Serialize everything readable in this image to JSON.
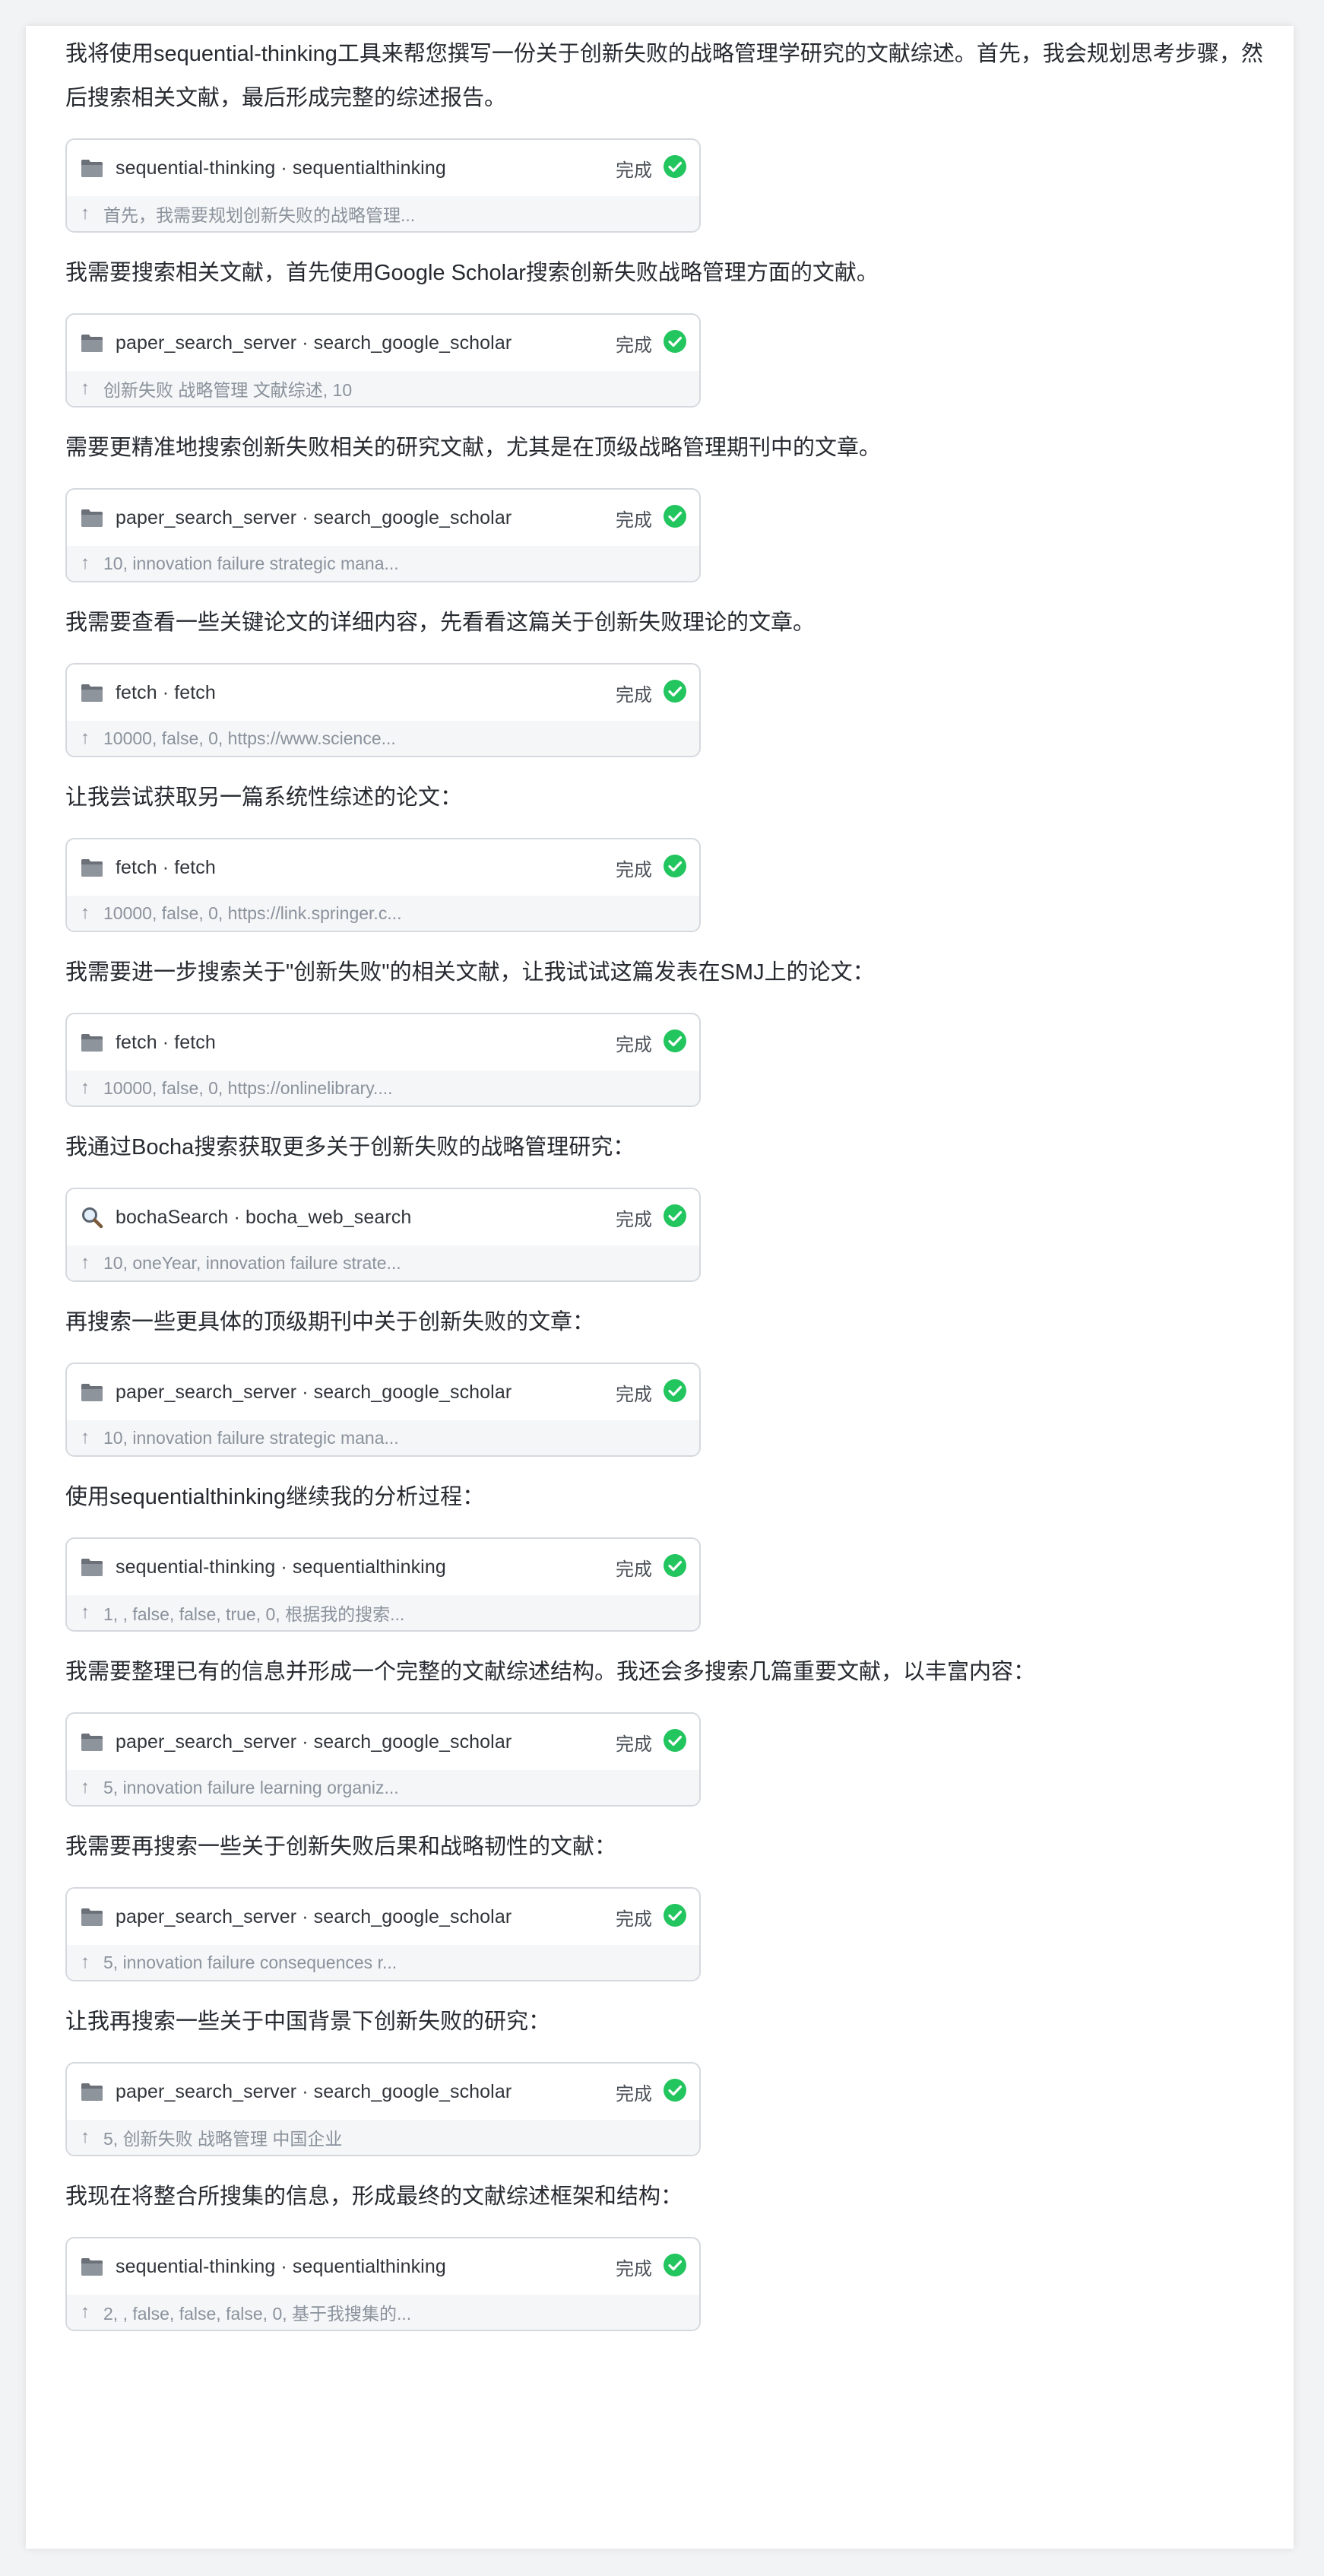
{
  "colors": {
    "success": "#22c55e",
    "card_border": "#d5d9de",
    "card_footer_bg": "#f5f6f8",
    "muted_text": "#8a929c"
  },
  "blocks": [
    {
      "text": "我将使用sequential-thinking工具来帮您撰写一份关于创新失败的战略管理学研究的文献综述。首先，我会规划思考步骤，然后搜索相关文献，最后形成完整的综述报告。",
      "tool": {
        "icon": "folder-icon",
        "name": "sequential-thinking · sequentialthinking",
        "status": "完成",
        "args": "首先，我需要规划创新失败的战略管理..."
      }
    },
    {
      "text": "我需要搜索相关文献，首先使用Google Scholar搜索创新失败战略管理方面的文献。",
      "tool": {
        "icon": "folder-icon",
        "name": "paper_search_server · search_google_scholar",
        "status": "完成",
        "args": "创新失败 战略管理 文献综述, 10"
      }
    },
    {
      "text": "需要更精准地搜索创新失败相关的研究文献，尤其是在顶级战略管理期刊中的文章。",
      "tool": {
        "icon": "folder-icon",
        "name": "paper_search_server · search_google_scholar",
        "status": "完成",
        "args": "10, innovation failure strategic mana..."
      }
    },
    {
      "text": "我需要查看一些关键论文的详细内容，先看看这篇关于创新失败理论的文章。",
      "tool": {
        "icon": "folder-icon",
        "name": "fetch · fetch",
        "status": "完成",
        "args": "10000, false, 0, https://www.science..."
      }
    },
    {
      "text": "让我尝试获取另一篇系统性综述的论文：",
      "tool": {
        "icon": "folder-icon",
        "name": "fetch · fetch",
        "status": "完成",
        "args": "10000, false, 0, https://link.springer.c..."
      }
    },
    {
      "text": "我需要进一步搜索关于\"创新失败\"的相关文献，让我试试这篇发表在SMJ上的论文：",
      "tool": {
        "icon": "folder-icon",
        "name": "fetch · fetch",
        "status": "完成",
        "args": "10000, false, 0, https://onlinelibrary...."
      }
    },
    {
      "text": "我通过Bocha搜索获取更多关于创新失败的战略管理研究：",
      "tool": {
        "icon": "search-icon",
        "name": "bochaSearch · bocha_web_search",
        "status": "完成",
        "args": "10, oneYear, innovation failure strate..."
      }
    },
    {
      "text": "再搜索一些更具体的顶级期刊中关于创新失败的文章：",
      "tool": {
        "icon": "folder-icon",
        "name": "paper_search_server · search_google_scholar",
        "status": "完成",
        "args": "10, innovation failure strategic mana..."
      }
    },
    {
      "text": "使用sequentialthinking继续我的分析过程：",
      "tool": {
        "icon": "folder-icon",
        "name": "sequential-thinking · sequentialthinking",
        "status": "完成",
        "args": "1, , false, false, true, 0, 根据我的搜索..."
      }
    },
    {
      "text": "我需要整理已有的信息并形成一个完整的文献综述结构。我还会多搜索几篇重要文献，以丰富内容：",
      "tool": {
        "icon": "folder-icon",
        "name": "paper_search_server · search_google_scholar",
        "status": "完成",
        "args": "5, innovation failure learning organiz..."
      }
    },
    {
      "text": "我需要再搜索一些关于创新失败后果和战略韧性的文献：",
      "tool": {
        "icon": "folder-icon",
        "name": "paper_search_server · search_google_scholar",
        "status": "完成",
        "args": "5, innovation failure consequences r..."
      }
    },
    {
      "text": "让我再搜索一些关于中国背景下创新失败的研究：",
      "tool": {
        "icon": "folder-icon",
        "name": "paper_search_server · search_google_scholar",
        "status": "完成",
        "args": "5, 创新失败 战略管理 中国企业"
      }
    },
    {
      "text": "我现在将整合所搜集的信息，形成最终的文献综述框架和结构：",
      "tool": {
        "icon": "folder-icon",
        "name": "sequential-thinking · sequentialthinking",
        "status": "完成",
        "args": "2, , false, false, false, 0, 基于我搜集的..."
      }
    }
  ]
}
